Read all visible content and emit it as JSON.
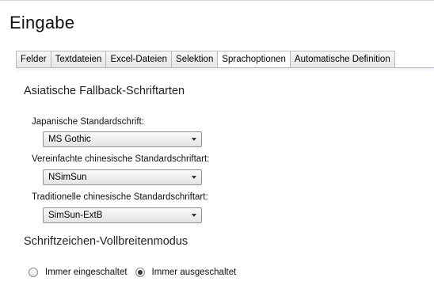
{
  "page": {
    "title": "Eingabe"
  },
  "tabs": [
    {
      "label": "Felder",
      "active": false
    },
    {
      "label": "Textdateien",
      "active": false
    },
    {
      "label": "Excel-Dateien",
      "active": false
    },
    {
      "label": "Selektion",
      "active": false
    },
    {
      "label": "Sprachoptionen",
      "active": true
    },
    {
      "label": "Automatische Definition",
      "active": false
    }
  ],
  "fallback": {
    "heading": "Asiatische Fallback-Schriftarten",
    "japanese": {
      "label": "Japanische Standardschrift:",
      "value": "MS Gothic"
    },
    "simplified": {
      "label": "Vereinfachte chinesische Standardschriftart:",
      "value": "NSimSun"
    },
    "traditional": {
      "label": "Traditionelle chinesische Standardschriftart:",
      "value": "SimSun-ExtB"
    }
  },
  "fullwidth": {
    "heading": "Schriftzeichen-Vollbreitenmodus",
    "options": [
      {
        "label": "Immer eingeschaltet",
        "selected": false
      },
      {
        "label": "Immer ausgeschaltet",
        "selected": true
      }
    ]
  }
}
